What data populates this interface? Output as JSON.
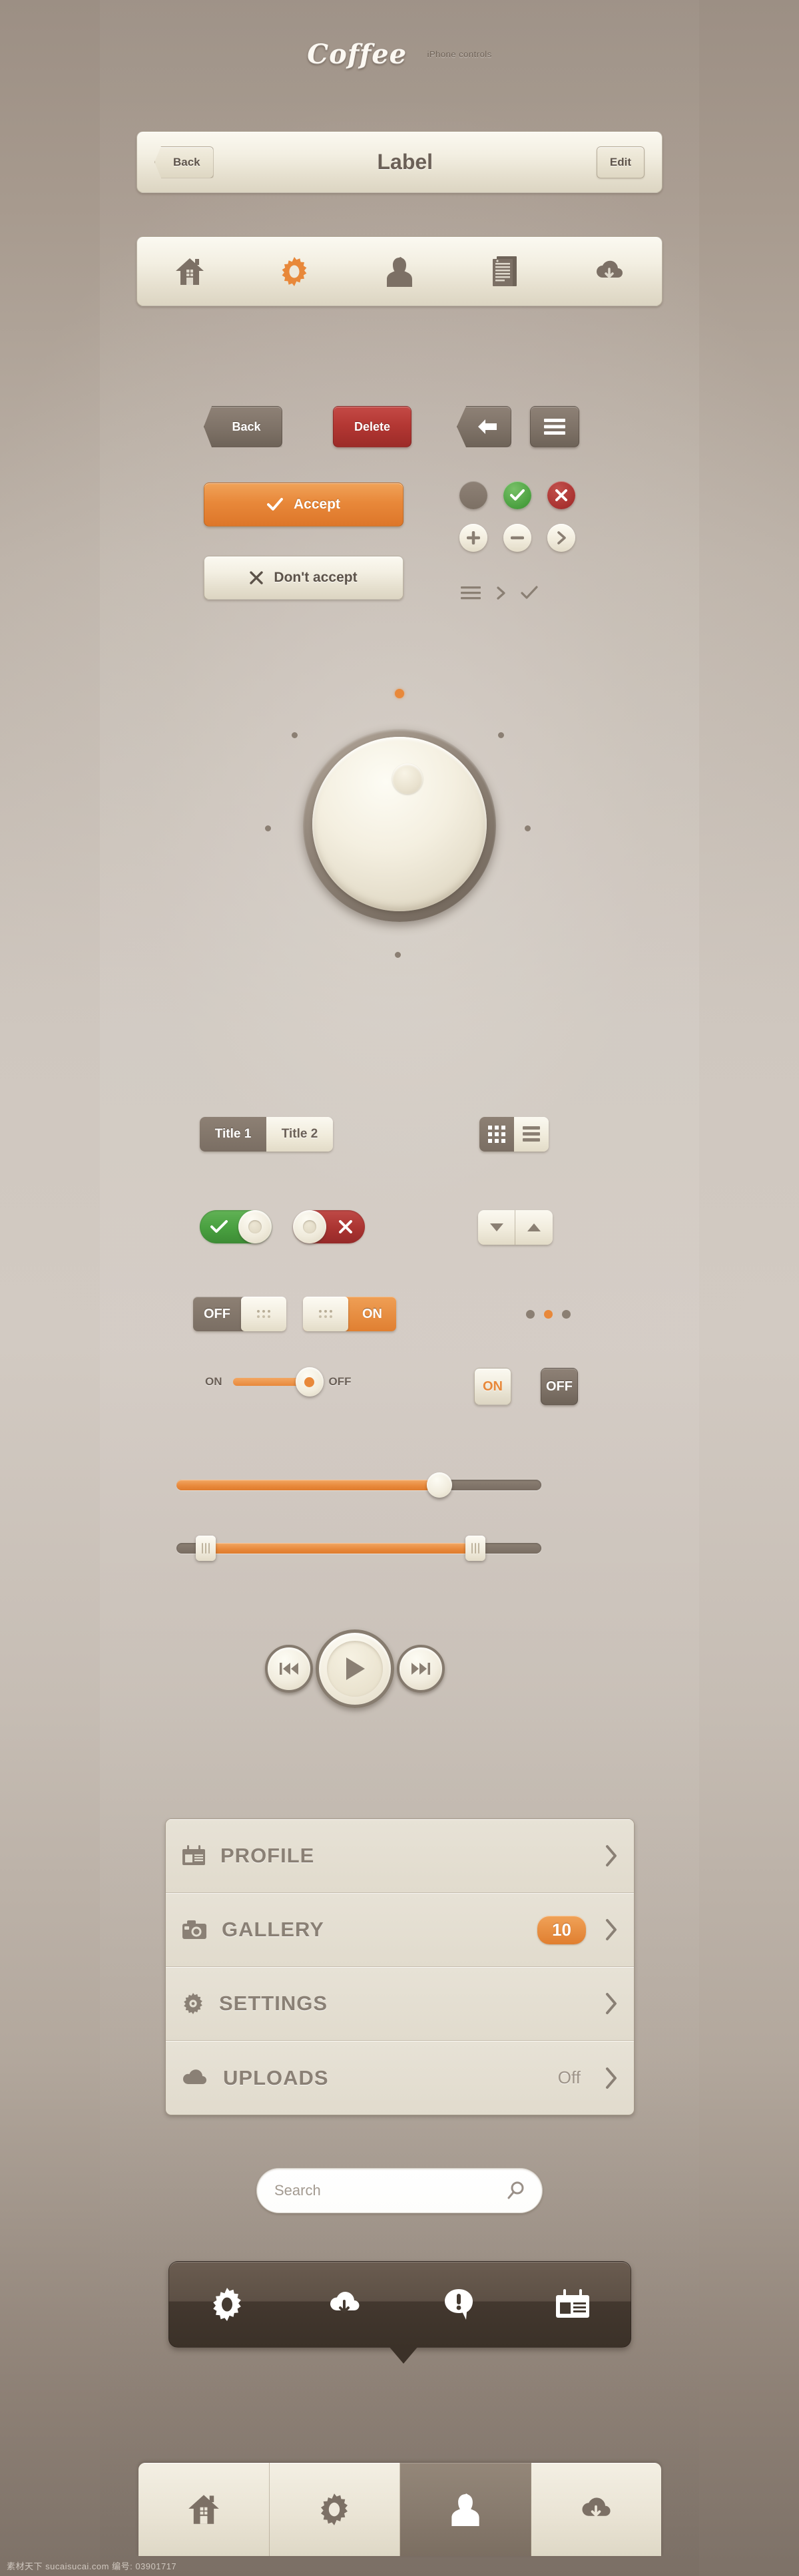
{
  "header": {
    "brand": "Coffee",
    "subtitle": "iPhone controls"
  },
  "navbar": {
    "back_label": "Back",
    "title": "Label",
    "edit_label": "Edit"
  },
  "iconbar": {
    "items": [
      {
        "icon": "home-icon",
        "active": false
      },
      {
        "icon": "gear-icon",
        "active": true
      },
      {
        "icon": "person-icon",
        "active": false
      },
      {
        "icon": "document-icon",
        "active": false
      },
      {
        "icon": "cloud-download-icon",
        "active": false
      }
    ]
  },
  "buttons": {
    "back_label": "Back",
    "delete_label": "Delete",
    "arrow_icon": "arrow-left-icon",
    "menu_icon": "hamburger-icon",
    "accept_label": "Accept",
    "accept_icon": "check-icon",
    "dont_accept_label": "Don't accept",
    "dont_accept_icon": "close-icon",
    "circles": [
      {
        "name": "blank-circle",
        "glyph": ""
      },
      {
        "name": "check-circle",
        "glyph": "check"
      },
      {
        "name": "close-circle",
        "glyph": "close"
      }
    ],
    "circles2": [
      {
        "name": "plus-circle",
        "glyph": "plus"
      },
      {
        "name": "minus-circle",
        "glyph": "minus"
      },
      {
        "name": "chevron-right-circle",
        "glyph": "chevron"
      }
    ],
    "mini_icons": [
      "list-icon",
      "chevron-right-icon",
      "check-icon"
    ]
  },
  "knob": {
    "value_dot_position": "top",
    "tick_count": 7
  },
  "segmented": {
    "title1": "Title 1",
    "title2": "Title 2",
    "selected": "Title 1",
    "view_grid_icon": "grid-view-icon",
    "view_list_icon": "list-view-icon",
    "view_selected": "grid"
  },
  "toggles": {
    "green_state": "on",
    "green_icon": "check-icon",
    "red_state": "off",
    "red_icon": "close-icon",
    "stepper_down_icon": "triangle-down-icon",
    "stepper_up_icon": "triangle-up-icon"
  },
  "switches": {
    "off_label": "OFF",
    "on_label": "ON",
    "dots_total": 3,
    "dots_active_index": 1,
    "slider_on_label": "ON",
    "slider_off_label": "OFF",
    "slider_state": "OFF",
    "btn_on_label": "ON",
    "btn_off_label": "OFF",
    "btn_selected": "ON"
  },
  "sliders": {
    "single": {
      "value_percent": 72
    },
    "range": {
      "low_percent": 8,
      "high_percent": 82
    }
  },
  "media": {
    "prev_icon": "skip-backward-icon",
    "play_icon": "play-icon",
    "next_icon": "skip-forward-icon"
  },
  "menu": {
    "rows": [
      {
        "icon": "profile-card-icon",
        "label": "PROFILE",
        "value": "",
        "badge": "",
        "accessory": "chevron-right-icon"
      },
      {
        "icon": "camera-icon",
        "label": "GALLERY",
        "value": "",
        "badge": "10",
        "accessory": "chevron-right-icon"
      },
      {
        "icon": "gear-icon",
        "label": "SETTINGS",
        "value": "",
        "badge": "",
        "accessory": "chevron-right-icon"
      },
      {
        "icon": "cloud-icon",
        "label": "UPLOADS",
        "value": "Off",
        "badge": "",
        "accessory": "chevron-right-icon"
      }
    ]
  },
  "search": {
    "placeholder": "Search",
    "value": "",
    "icon": "search-icon"
  },
  "popover": {
    "items": [
      {
        "icon": "gear-icon"
      },
      {
        "icon": "cloud-download-icon"
      },
      {
        "icon": "alert-icon"
      },
      {
        "icon": "profile-card-icon"
      }
    ]
  },
  "bottom_tabs": {
    "items": [
      {
        "icon": "home-icon",
        "active": false
      },
      {
        "icon": "gear-icon",
        "active": false
      },
      {
        "icon": "person-icon",
        "active": true
      },
      {
        "icon": "cloud-download-icon",
        "active": false
      }
    ]
  },
  "watermark": "素材天下 sucaisucai.com  编号: 03901717",
  "colors": {
    "accent": "#e8883a",
    "danger": "#b33733",
    "success": "#4ea244",
    "dark": "#7a6e63",
    "cream": "#f2eddf"
  }
}
